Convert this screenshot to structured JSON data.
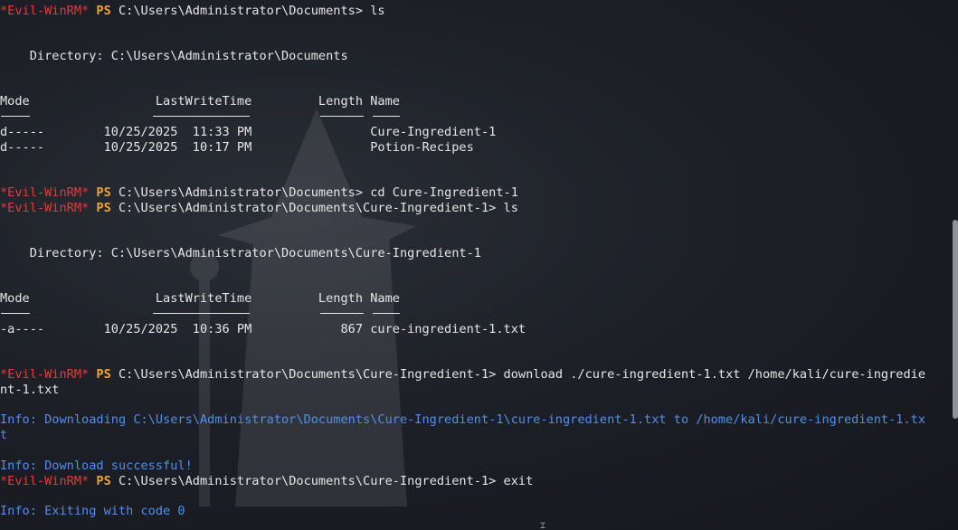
{
  "terminal": {
    "prompt_host": "*Evil-WinRM*",
    "prompt_ps": "PS",
    "cmd1": " C:\\Users\\Administrator\\Documents> ls",
    "dir1": "    Directory: C:\\Users\\Administrator\\Documents",
    "hdr1": "Mode                 LastWriteTime         Length Name",
    "rows1": [
      "d-----        10/25/2025  11:33 PM                Cure-Ingredient-1",
      "d-----        10/25/2025  10:17 PM                Potion-Recipes"
    ],
    "cmd2": " C:\\Users\\Administrator\\Documents> cd Cure-Ingredient-1",
    "cmd3": " C:\\Users\\Administrator\\Documents\\Cure-Ingredient-1> ls",
    "dir2": "    Directory: C:\\Users\\Administrator\\Documents\\Cure-Ingredient-1",
    "hdr2": "Mode                 LastWriteTime         Length Name",
    "rows2": [
      "-a----        10/25/2025  10:36 PM            867 cure-ingredient-1.txt"
    ],
    "cmd4a": " C:\\Users\\Administrator\\Documents\\Cure-Ingredient-1> download ./cure-ingredient-1.txt /home/kali/cure-ingredie",
    "cmd4b": "nt-1.txt",
    "info1a": "Info: Downloading C:\\Users\\Administrator\\Documents\\Cure-Ingredient-1\\cure-ingredient-1.txt to /home/kali/cure-ingredient-1.tx",
    "info1b": "t",
    "info2": "Info: Download successful!",
    "cmd5": " C:\\Users\\Administrator\\Documents\\Cure-Ingredient-1> exit",
    "info3": "Info: Exiting with code 0"
  },
  "colors": {
    "prompt_host": "#e03c3c",
    "prompt_ps": "#f0a33a",
    "info": "#4f8ff0",
    "text": "#e6e6e6"
  }
}
